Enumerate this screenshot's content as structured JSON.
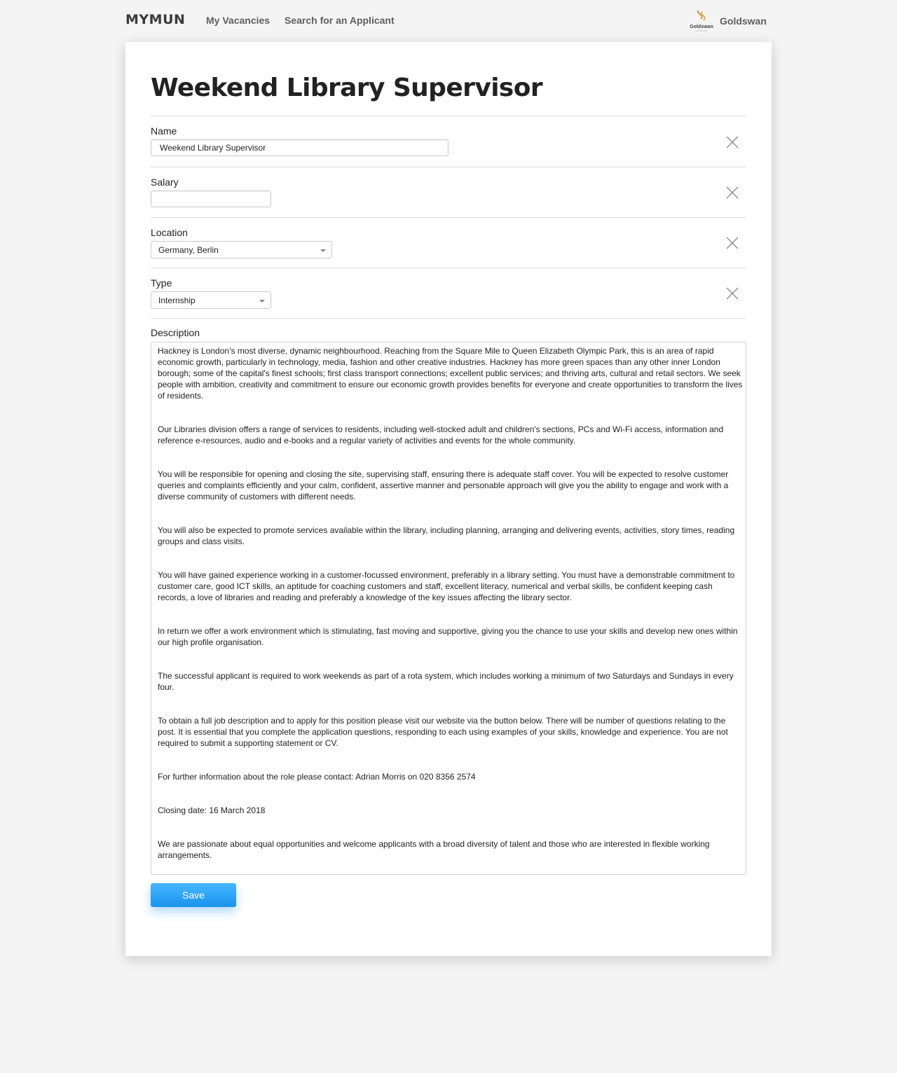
{
  "nav": {
    "brand": "MYMUN",
    "links": [
      "My Vacancies",
      "Search for an Applicant"
    ],
    "org_name": "Goldswan",
    "org_logo_text": "Goldswan"
  },
  "page": {
    "title": "Weekend Library Supervisor"
  },
  "form": {
    "name": {
      "label": "Name",
      "value": "Weekend Library Supervisor"
    },
    "salary": {
      "label": "Salary",
      "value": ""
    },
    "location": {
      "label": "Location",
      "value": "Germany, Berlin"
    },
    "type": {
      "label": "Type",
      "value": "Internship"
    },
    "description": {
      "label": "Description",
      "paragraphs": [
        "Hackney is London’s most diverse, dynamic neighbourhood. Reaching from the Square Mile to Queen Elizabeth Olympic Park, this is an area of rapid economic growth, particularly in technology, media, fashion and other creative industries. Hackney has more green spaces than any other inner London borough; some of the capital's finest schools; first class transport connections; excellent public services; and thriving arts, cultural and retail sectors. We seek people with ambition, creativity and commitment to ensure our economic growth provides benefits for everyone and create opportunities to transform the lives of residents.",
        "Our Libraries division offers a range of services to residents, including well-stocked adult and children's sections, PCs and Wi-Fi access, information and reference e-resources, audio and e-books and a regular variety of activities and events for the whole community.",
        "You will be responsible for opening and closing the site, supervising staff, ensuring there is adequate staff cover. You will be expected to resolve customer queries and complaints efficiently and your calm, confident, assertive manner and personable approach will give you the ability to engage and work with a diverse community of customers with different needs.",
        "You will also be expected to promote services available within the library, including planning, arranging and delivering events, activities, story times, reading groups and class visits.",
        "You will have gained experience working in a customer-focussed environment, preferably in a library setting. You must have a demonstrable commitment to customer care, good ICT skills, an aptitude for coaching customers and staff, excellent literacy, numerical and verbal skills, be confident keeping cash records, a love of libraries and reading and preferably a knowledge of the key issues affecting the library sector.",
        "In return we offer a work environment which is stimulating, fast moving and supportive, giving you the chance to use your skills and develop new ones within our high profile organisation.",
        "The successful applicant is required to work weekends as part of a rota system, which includes working a minimum of two Saturdays and Sundays in every four.",
        "To obtain a full job description and to apply for this position please visit our website via the button below. There will be number of questions relating to the post. It is essential that you complete the application questions, responding to each using examples of your skills, knowledge and experience. You are not required to submit a supporting statement or CV.",
        "For further information about the role please contact: Adrian Morris on 020 8356 2574",
        "Closing date: 16 March 2018",
        "We are passionate about equal opportunities and welcome applicants with a broad diversity of talent and those who are interested in flexible working arrangements."
      ]
    },
    "save_label": "Save"
  },
  "colors": {
    "accent": "#1a93ee",
    "logo_gold": "#c9a35a"
  },
  "icons": {
    "remove": "close-icon",
    "dropdown": "chevron-down-icon"
  }
}
